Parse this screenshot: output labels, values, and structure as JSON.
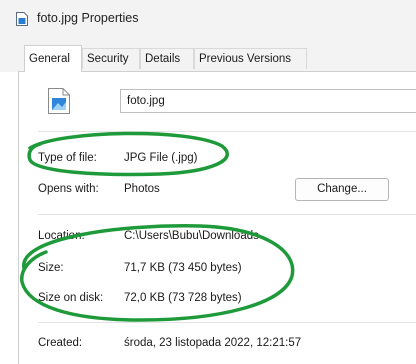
{
  "window": {
    "title": "foto.jpg Properties",
    "title_icon": "file-icon"
  },
  "tabs": [
    {
      "label": "General",
      "active": true
    },
    {
      "label": "Security",
      "active": false
    },
    {
      "label": "Details",
      "active": false
    },
    {
      "label": "Previous Versions",
      "active": false
    }
  ],
  "general": {
    "file_icon": "image-file-icon",
    "filename": "foto.jpg",
    "type_label": "Type of file:",
    "type_value": "JPG File (.jpg)",
    "opens_label": "Opens with:",
    "opens_value": "Photos",
    "change_button": "Change...",
    "location_label": "Location:",
    "location_value": "C:\\Users\\Bubu\\Downloads",
    "size_label": "Size:",
    "size_value": "71,7 KB (73 450 bytes)",
    "size_on_disk_label": "Size on disk:",
    "size_on_disk_value": "72,0 KB (73 728 bytes)",
    "created_label": "Created:",
    "created_value": "środa, 23 listopada 2022, 12:21:57"
  },
  "annotation_color": "#1f9a3a"
}
